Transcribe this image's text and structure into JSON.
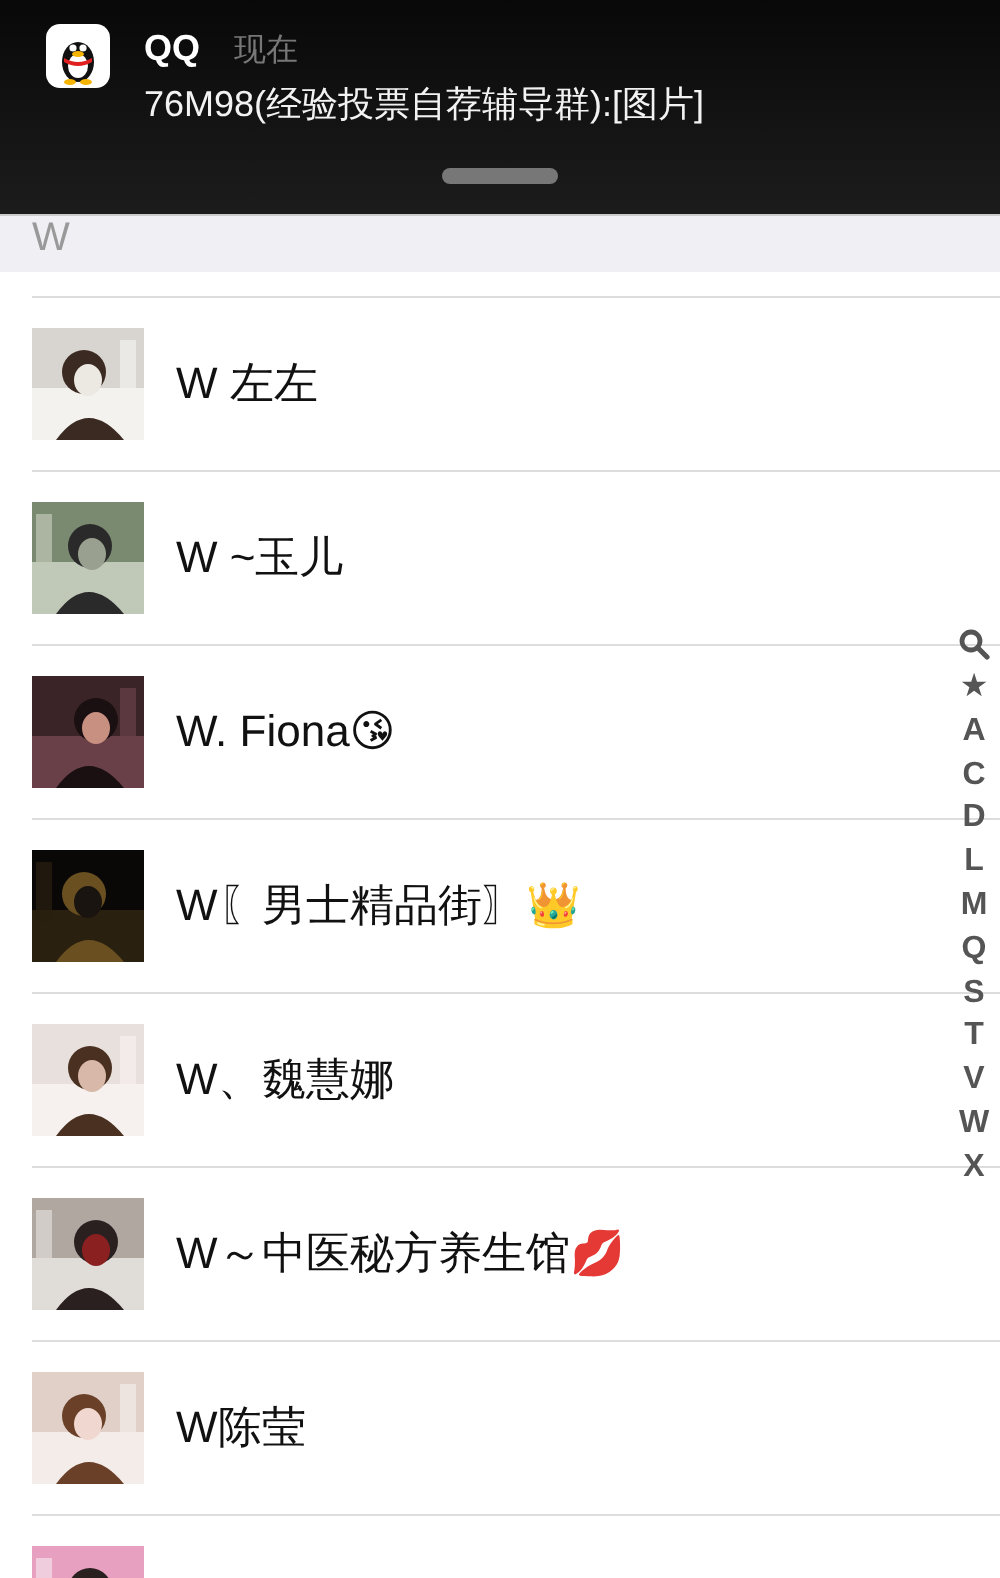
{
  "notification": {
    "app": "QQ",
    "time": "现在",
    "message": "76M98(经验投票自荐辅导群):[图片]"
  },
  "section": {
    "title": "W"
  },
  "contacts": [
    {
      "name": "W 左左",
      "avatar": {
        "kind": "picture"
      }
    },
    {
      "name": "W ~玉儿",
      "avatar": {
        "kind": "picture"
      }
    },
    {
      "name": "W. Fiona😘",
      "avatar": {
        "kind": "picture"
      }
    },
    {
      "name": "W〖男士精品街〗👑",
      "avatar": {
        "kind": "picture"
      }
    },
    {
      "name": "W、魏慧娜",
      "avatar": {
        "kind": "picture"
      }
    },
    {
      "name": "W～中医秘方养生馆💋",
      "avatar": {
        "kind": "picture"
      }
    },
    {
      "name": "W陈莹",
      "avatar": {
        "kind": "picture"
      }
    },
    {
      "avatar": {
        "kind": "picture"
      }
    }
  ],
  "index_bar": {
    "letters": [
      "★",
      "A",
      "C",
      "D",
      "L",
      "M",
      "Q",
      "S",
      "T",
      "V",
      "W",
      "X"
    ]
  }
}
